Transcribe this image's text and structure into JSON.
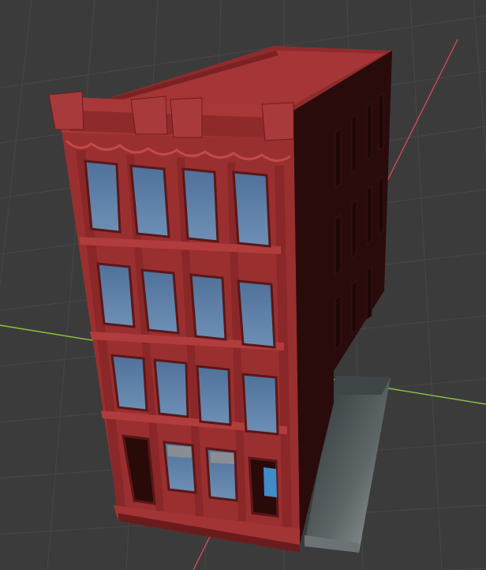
{
  "viewport": {
    "background": "#3b3b3b",
    "grid_color": "#4a4a4a",
    "x_axis_color": "#d24b52",
    "y_axis_color": "#8cc63f"
  },
  "building": {
    "floors": 4,
    "bays": 4,
    "brick_color": "#9a2f30",
    "brick_shadow": "#4a1414",
    "side_color": "#2a0b0b",
    "glass_color": "#5b7fa8",
    "sidewalk_color": "#8e9396"
  }
}
